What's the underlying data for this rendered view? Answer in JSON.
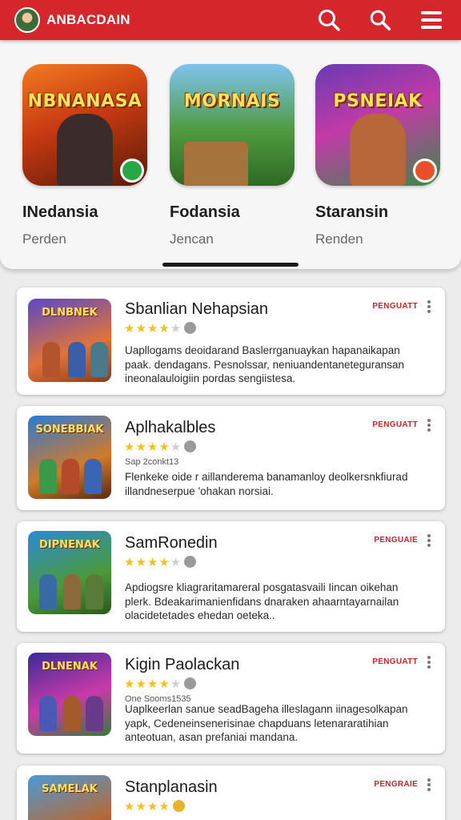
{
  "header": {
    "app_title": "ANBACDAIN",
    "icons": [
      "avatar",
      "search-icon",
      "search-icon",
      "menu-icon"
    ],
    "color": "#d4262b"
  },
  "featured": [
    {
      "name": "INedansia",
      "sub": "Perden",
      "thumb_text": "NBNANASA",
      "badge_color": "#27a745"
    },
    {
      "name": "Fodansia",
      "sub": "Jencan",
      "thumb_text": "MORNAIS",
      "badge_color": ""
    },
    {
      "name": "Staransin",
      "sub": "Renden",
      "thumb_text": "PSNEIAK",
      "badge_color": "#e9502a"
    }
  ],
  "list": [
    {
      "thumb_text": "DLNBNEK",
      "title": "Sbanlian Nehapsian",
      "badge": "PENGUATT",
      "rating": 4,
      "meta": "",
      "description": "Uapllogams deoidarand Baslerrganuaykan hapanaikapan paak. dendagans. Pesnolssar, neniuandentaneteguransan ineonalauloigiin pordas sengiistesa."
    },
    {
      "thumb_text": "SONEBBIAK",
      "title": "Aplhakalbles",
      "badge": "PENGUATT",
      "rating": 4,
      "meta": "Sap 2conkt13",
      "description": "Flenkeke oide r aillanderema banamanloy deolkersnkfiurad illandneserpue 'ohakan norsiai."
    },
    {
      "thumb_text": "DIPNENAK",
      "title": "SamRonedin",
      "badge": "PENGUAIE",
      "rating": 4,
      "meta": "",
      "description": "Apdiogsre kliagraritamareral posgatasvaili Iincan oikehan plerk. Bdeakarimanienfidans dnaraken ahaarntayarnailan olacidetetades ehedan oeteka.."
    },
    {
      "thumb_text": "DLNENAK",
      "title": "Kigin Paolackan",
      "badge": "PENGUATT",
      "rating": 4,
      "meta": "One Sooms1535",
      "description": "Uaplkeerlan sanue seadBageha illeslagann iinagesolkapan yapk, Cedeneinsenerisinae chapduans letenararatihian anteotuan, asan prefaniai mandana."
    },
    {
      "thumb_text": "SAMELAK",
      "title": "Stanplanasin",
      "badge": "PENGRAIE",
      "rating": 4,
      "meta": "",
      "description": ""
    }
  ]
}
